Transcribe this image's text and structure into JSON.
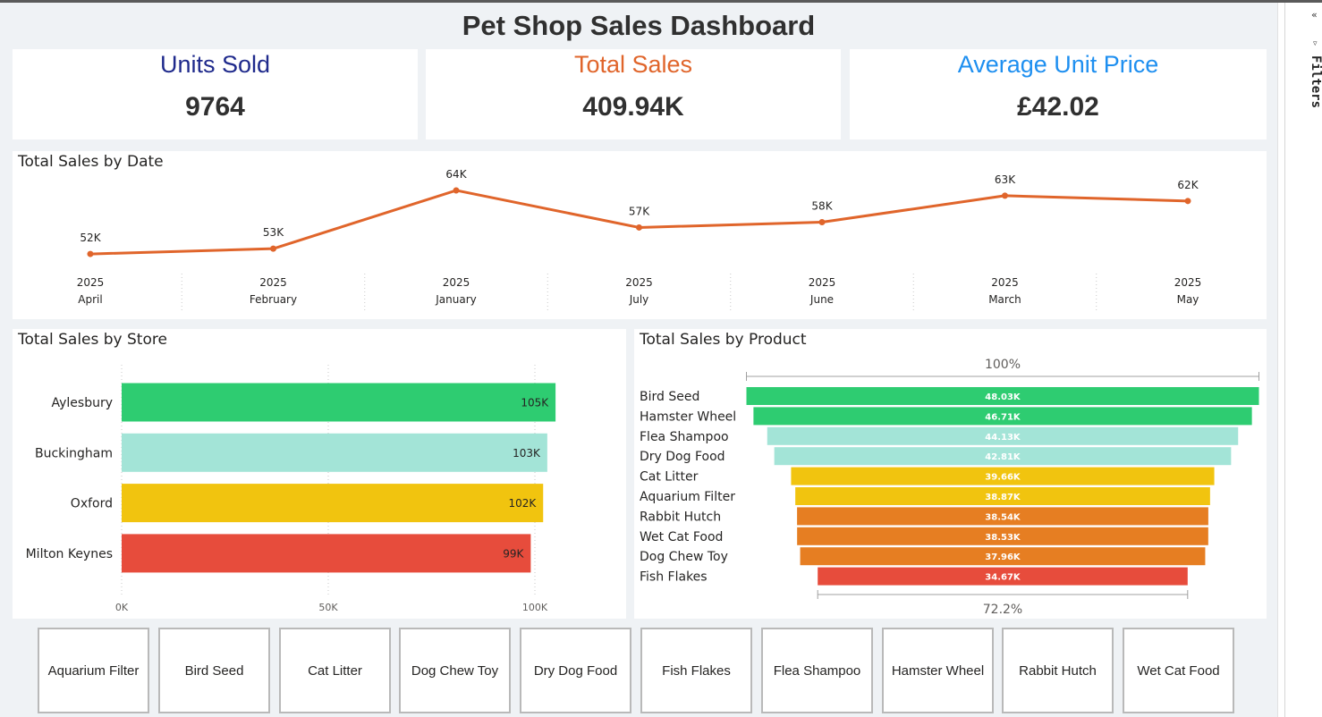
{
  "dashboard": {
    "title": "Pet Shop Sales Dashboard"
  },
  "kpis": [
    {
      "title": "Units Sold",
      "value": "9764",
      "color": "#1f2a8c"
    },
    {
      "title": "Total Sales",
      "value": "409.94K",
      "color": "#e0652b"
    },
    {
      "title": "Average Unit Price",
      "value": "£42.02",
      "color": "#1e8ff0"
    }
  ],
  "date_chart": {
    "title": "Total Sales by Date",
    "chart_data": {
      "type": "line",
      "title": "Total Sales by Date",
      "color": "#e0652b",
      "categories": [
        {
          "year": "2025",
          "month": "April"
        },
        {
          "year": "2025",
          "month": "February"
        },
        {
          "year": "2025",
          "month": "January"
        },
        {
          "year": "2025",
          "month": "July"
        },
        {
          "year": "2025",
          "month": "June"
        },
        {
          "year": "2025",
          "month": "March"
        },
        {
          "year": "2025",
          "month": "May"
        }
      ],
      "values": [
        52,
        53,
        64,
        57,
        58,
        63,
        62
      ],
      "labels": [
        "52K",
        "53K",
        "64K",
        "57K",
        "58K",
        "63K",
        "62K"
      ],
      "ylim": [
        51,
        64.5
      ]
    }
  },
  "store_chart": {
    "title": "Total Sales by Store",
    "chart_data": {
      "type": "bar",
      "orientation": "horizontal",
      "title": "Total Sales by Store",
      "categories": [
        "Aylesbury",
        "Buckingham",
        "Oxford",
        "Milton Keynes"
      ],
      "values": [
        105,
        103,
        102,
        99
      ],
      "labels": [
        "105K",
        "103K",
        "102K",
        "99K"
      ],
      "colors": [
        "#2ecc71",
        "#a3e4d7",
        "#f1c40f",
        "#e74c3c"
      ],
      "xticks": [
        0,
        50,
        100
      ],
      "xtick_labels": [
        "0K",
        "50K",
        "100K"
      ],
      "xlim": [
        0,
        100
      ]
    }
  },
  "product_chart": {
    "title": "Total Sales by Product",
    "chart_data": {
      "type": "funnel",
      "title": "Total Sales by Product",
      "top_label": "100%",
      "bottom_label": "72.2%",
      "categories": [
        "Bird Seed",
        "Hamster Wheel",
        "Flea Shampoo",
        "Dry Dog Food",
        "Cat Litter",
        "Aquarium Filter",
        "Rabbit Hutch",
        "Wet Cat Food",
        "Dog Chew Toy",
        "Fish Flakes"
      ],
      "values": [
        48.03,
        46.71,
        44.13,
        42.81,
        39.66,
        38.87,
        38.54,
        38.53,
        37.96,
        34.67
      ],
      "labels": [
        "48.03K",
        "46.71K",
        "44.13K",
        "42.81K",
        "39.66K",
        "38.87K",
        "38.54K",
        "38.53K",
        "37.96K",
        "34.67K"
      ],
      "colors": [
        "#2ecc71",
        "#2ecc71",
        "#a3e4d7",
        "#a3e4d7",
        "#f1c40f",
        "#f1c40f",
        "#e67e22",
        "#e67e22",
        "#e67e22",
        "#e74c3c"
      ]
    }
  },
  "slicers": [
    "Aquarium Filter",
    "Bird Seed",
    "Cat Litter",
    "Dog Chew Toy",
    "Dry Dog Food",
    "Fish Flakes",
    "Flea Shampoo",
    "Hamster Wheel",
    "Rabbit Hutch",
    "Wet Cat Food"
  ],
  "filters_pane": {
    "label": "Filters",
    "collapse_glyph": "«"
  }
}
